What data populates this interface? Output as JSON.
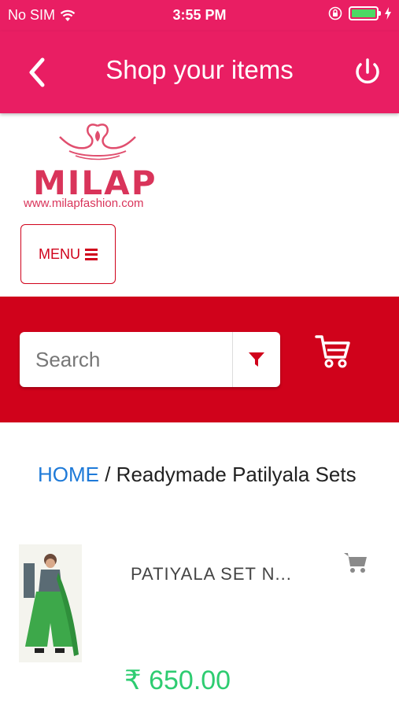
{
  "status_bar": {
    "carrier": "No SIM",
    "time": "3:55 PM"
  },
  "header": {
    "title": "Shop your items"
  },
  "logo": {
    "brand": "MILAP",
    "url": "www.milapfashion.com"
  },
  "menu": {
    "label": "MENU"
  },
  "search": {
    "placeholder": "Search"
  },
  "breadcrumb": {
    "home": "HOME",
    "separator": " / ",
    "current": "Readymade Patilyala Sets"
  },
  "products": [
    {
      "name": "PATIYALA SET N...",
      "currency": "₹",
      "price": "650.00"
    }
  ],
  "colors": {
    "app_bar": "#e91e63",
    "search_band": "#d0021b",
    "price": "#2ecc71",
    "home_link": "#1e7ad8"
  }
}
